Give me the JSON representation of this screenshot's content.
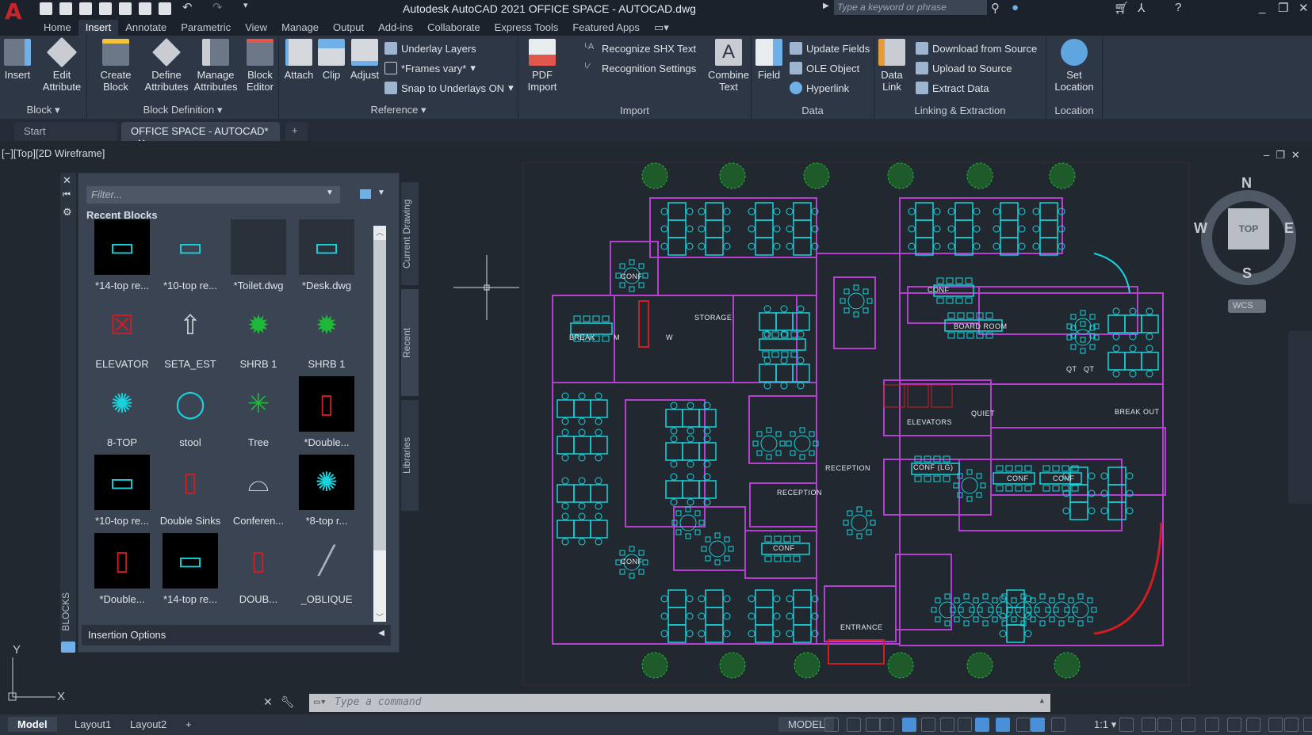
{
  "app": {
    "title": "Autodesk AutoCAD 2021   OFFICE SPACE - AUTOCAD.dwg",
    "search_placeholder": "Type a keyword or phrase"
  },
  "ribbon_tabs": [
    "Home",
    "Insert",
    "Annotate",
    "Parametric",
    "View",
    "Manage",
    "Output",
    "Add-ins",
    "Collaborate",
    "Express Tools",
    "Featured Apps"
  ],
  "ribbon": {
    "block": {
      "title": "Block",
      "insert": "Insert",
      "edit_attribute": "Edit Attribute"
    },
    "block_definition": {
      "title": "Block Definition",
      "create_block": "Create Block",
      "define_attributes": "Define Attributes",
      "manage_attributes": "Manage Attributes",
      "block_editor": "Block Editor"
    },
    "reference": {
      "title": "Reference",
      "attach": "Attach",
      "clip": "Clip",
      "adjust": "Adjust",
      "underlay_layers": "Underlay Layers",
      "frames_vary": "*Frames vary*",
      "snap_underlays": "Snap to Underlays ON"
    },
    "import": {
      "title": "Import",
      "pdf_import": "PDF Import",
      "recognize_shx": "Recognize SHX Text",
      "recognition_settings": "Recognition Settings",
      "combine_text": "Combine Text"
    },
    "data": {
      "title": "Data",
      "field": "Field",
      "update_fields": "Update Fields",
      "ole_object": "OLE Object",
      "hyperlink": "Hyperlink"
    },
    "linking": {
      "title": "Linking & Extraction",
      "data_link": "Data Link",
      "download": "Download from Source",
      "upload": "Upload to Source",
      "extract": "Extract  Data"
    },
    "location": {
      "title": "Location",
      "set_location": "Set Location"
    }
  },
  "file_tabs": {
    "start": "Start",
    "active": "OFFICE SPACE - AUTOCAD*"
  },
  "viewport_label": "[−][Top][2D Wireframe]",
  "palette": {
    "filter_placeholder": "Filter...",
    "section": "Recent Blocks",
    "insertion_options": "Insertion Options",
    "side_label": "BLOCKS",
    "tabs": [
      "Current Drawing",
      "Recent",
      "Libraries"
    ],
    "blocks": [
      "*14-top re...",
      "*10-top re...",
      "*Toilet.dwg",
      "*Desk.dwg",
      "ELEVATOR",
      "SETA_EST",
      "SHRB 1",
      "SHRB 1",
      "8-TOP",
      "stool",
      "Tree",
      "*Double...",
      "*10-top re...",
      "Double Sinks",
      "Conferen...",
      "*8-top r...",
      "*Double...",
      "*14-top re...",
      "DOUB...",
      "_OBLIQUE"
    ]
  },
  "viewcube": {
    "n": "N",
    "s": "S",
    "e": "E",
    "w": "W",
    "top": "TOP",
    "wcs": "WCS"
  },
  "plan": {
    "labels": [
      "STORAGE",
      "BREAK",
      "CONF",
      "M",
      "W",
      "BOARD ROOM",
      "ELEVATORS",
      "RECEPTION",
      "RECEPTION",
      "ENTRANCE",
      "BREAK OUT",
      "QUIET",
      "CONF (LG)",
      "CONF",
      "CONF",
      "CONF",
      "CONF",
      "CONF",
      "QT",
      "QT"
    ]
  },
  "ucs": {
    "x": "X",
    "y": "Y"
  },
  "command": {
    "placeholder": "Type a command"
  },
  "layout_tabs": [
    "Model",
    "Layout1",
    "Layout2"
  ],
  "status": {
    "model": "MODEL",
    "scale": "1:1"
  },
  "colors": {
    "cyan": "#19d3dc",
    "magenta": "#b43fd1",
    "green": "#20b83a",
    "red": "#d01e22",
    "accent": "#4a90d9"
  }
}
